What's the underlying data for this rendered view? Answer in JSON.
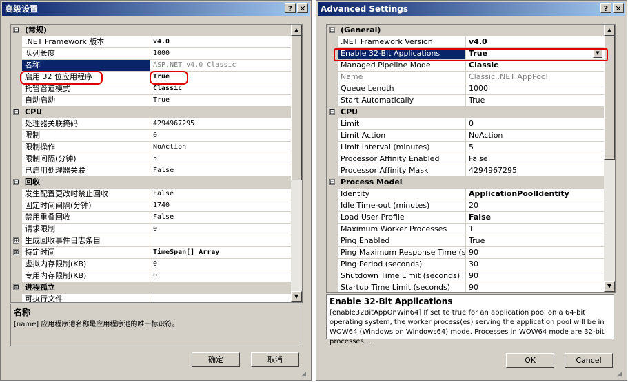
{
  "left": {
    "title": "高级设置",
    "help_btn": "?",
    "close_btn": "✕",
    "rows": [
      {
        "type": "cat",
        "box": "⊟",
        "name": "(常规)"
      },
      {
        "type": "prop",
        "name": ".NET Framework 版本",
        "value": "v4.0",
        "bold": true
      },
      {
        "type": "prop",
        "name": "队列长度",
        "value": "1000"
      },
      {
        "type": "prop",
        "name": "名称",
        "value": "ASP.NET v4.0 Classic",
        "sel": true,
        "gray": true
      },
      {
        "type": "prop",
        "name": "启用 32 位应用程序",
        "value": "True",
        "bold": true
      },
      {
        "type": "prop",
        "name": "托管管道模式",
        "value": "Classic",
        "bold": true
      },
      {
        "type": "prop",
        "name": "自动启动",
        "value": "True"
      },
      {
        "type": "cat",
        "box": "⊟",
        "name": "CPU"
      },
      {
        "type": "prop",
        "name": "处理器关联掩码",
        "value": "4294967295"
      },
      {
        "type": "prop",
        "name": "限制",
        "value": "0"
      },
      {
        "type": "prop",
        "name": "限制操作",
        "value": "NoAction"
      },
      {
        "type": "prop",
        "name": "限制间隔(分钟)",
        "value": "5"
      },
      {
        "type": "prop",
        "name": "已启用处理器关联",
        "value": "False"
      },
      {
        "type": "cat",
        "box": "⊟",
        "name": "回收"
      },
      {
        "type": "prop",
        "name": "发生配置更改时禁止回收",
        "value": "False"
      },
      {
        "type": "prop",
        "name": "固定时间间隔(分钟)",
        "value": "1740"
      },
      {
        "type": "prop",
        "name": "禁用重叠回收",
        "value": "False"
      },
      {
        "type": "prop",
        "name": "请求限制",
        "value": "0"
      },
      {
        "type": "propx",
        "box": "⊞",
        "name": "生成回收事件日志条目",
        "value": ""
      },
      {
        "type": "propx",
        "box": "⊞",
        "name": "特定时间",
        "value": "TimeSpan[] Array",
        "bold": true
      },
      {
        "type": "prop",
        "name": "虚拟内存限制(KB)",
        "value": "0"
      },
      {
        "type": "prop",
        "name": "专用内存限制(KB)",
        "value": "0"
      },
      {
        "type": "cat",
        "box": "⊟",
        "name": "进程孤立"
      },
      {
        "type": "prop",
        "name": "可执行文件",
        "value": ""
      }
    ],
    "desc_title": "名称",
    "desc_text": "[name] 应用程序池名称是应用程序池的唯一标识符。",
    "ok": "确定",
    "cancel": "取消"
  },
  "right": {
    "title": "Advanced Settings",
    "help_btn": "?",
    "close_btn": "✕",
    "rows": [
      {
        "type": "cat",
        "box": "⊟",
        "name": "(General)"
      },
      {
        "type": "prop",
        "name": ".NET Framework Version",
        "value": "v4.0",
        "bold": true
      },
      {
        "type": "prop",
        "name": "Enable 32-Bit Applications",
        "value": "True",
        "bold": true,
        "sel": true,
        "dropdown": true
      },
      {
        "type": "prop",
        "name": "Managed Pipeline Mode",
        "value": "Classic",
        "bold": true
      },
      {
        "type": "prop",
        "name": "Name",
        "value": "Classic .NET AppPool",
        "gray": true,
        "grayname": true
      },
      {
        "type": "prop",
        "name": "Queue Length",
        "value": "1000"
      },
      {
        "type": "prop",
        "name": "Start Automatically",
        "value": "True"
      },
      {
        "type": "cat",
        "box": "⊟",
        "name": "CPU"
      },
      {
        "type": "prop",
        "name": "Limit",
        "value": "0"
      },
      {
        "type": "prop",
        "name": "Limit Action",
        "value": "NoAction"
      },
      {
        "type": "prop",
        "name": "Limit Interval (minutes)",
        "value": "5"
      },
      {
        "type": "prop",
        "name": "Processor Affinity Enabled",
        "value": "False"
      },
      {
        "type": "prop",
        "name": "Processor Affinity Mask",
        "value": "4294967295"
      },
      {
        "type": "cat",
        "box": "⊟",
        "name": "Process Model"
      },
      {
        "type": "prop",
        "name": "Identity",
        "value": "ApplicationPoolIdentity",
        "bold": true
      },
      {
        "type": "prop",
        "name": "Idle Time-out (minutes)",
        "value": "20"
      },
      {
        "type": "prop",
        "name": "Load User Profile",
        "value": "False",
        "bold": true
      },
      {
        "type": "prop",
        "name": "Maximum Worker Processes",
        "value": "1"
      },
      {
        "type": "prop",
        "name": "Ping Enabled",
        "value": "True"
      },
      {
        "type": "prop",
        "name": "Ping Maximum Response Time (seconds)",
        "value": "90"
      },
      {
        "type": "prop",
        "name": "Ping Period (seconds)",
        "value": "30"
      },
      {
        "type": "prop",
        "name": "Shutdown Time Limit (seconds)",
        "value": "90"
      },
      {
        "type": "prop",
        "name": "Startup Time Limit (seconds)",
        "value": "90"
      }
    ],
    "desc_title": "Enable 32-Bit Applications",
    "desc_text": "[enable32BitAppOnWin64] If set to true for an application pool on a 64-bit operating system, the worker process(es) serving the application pool will be in WOW64 (Windows on Windows64) mode. Processes in WOW64 mode are 32-bit processes…",
    "ok": "OK",
    "cancel": "Cancel"
  }
}
